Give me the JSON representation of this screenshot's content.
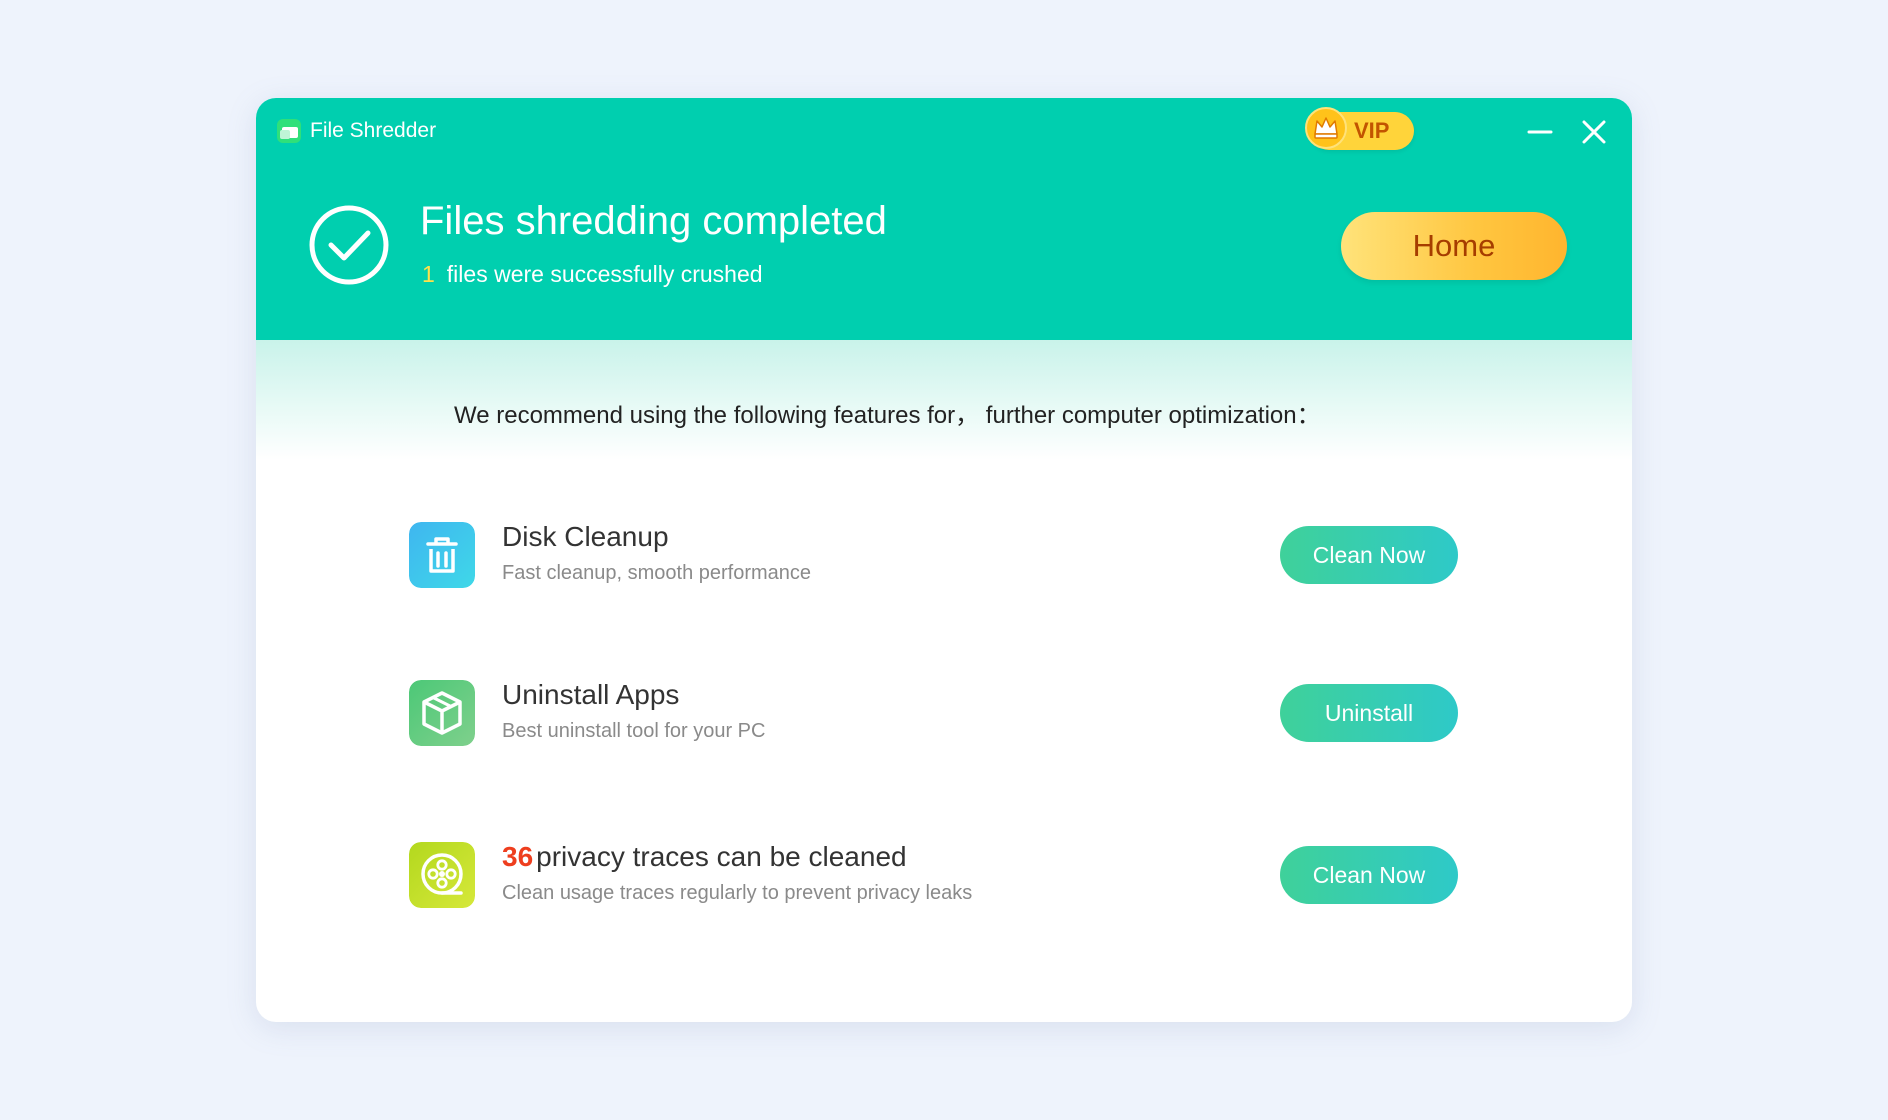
{
  "window": {
    "title": "File Shredder",
    "vip_label": "VIP"
  },
  "header": {
    "headline": "Files shredding completed",
    "count": "1",
    "count_suffix": "files were successfully crushed",
    "home_label": "Home"
  },
  "recommend_text": "We recommend using the following features for， further computer optimization：",
  "features": [
    {
      "title": "Disk Cleanup",
      "description": "Fast cleanup, smooth performance",
      "button": "Clean Now",
      "icon": "trash-can-icon"
    },
    {
      "title": "Uninstall Apps",
      "description": "Best uninstall tool for your PC",
      "button": "Uninstall",
      "icon": "package-box-icon"
    },
    {
      "count": "36",
      "title": "privacy traces can be cleaned",
      "description": "Clean usage traces regularly to prevent privacy leaks",
      "button": "Clean Now",
      "icon": "film-reel-icon"
    }
  ],
  "colors": {
    "header_bg": "#00cfaf",
    "vip_bg": "#ffd43a",
    "home_btn": "#ffc640",
    "action_btn": "#3fd19a",
    "traces_count": "#ee3e1e",
    "count_highlight": "#ffe14a"
  }
}
